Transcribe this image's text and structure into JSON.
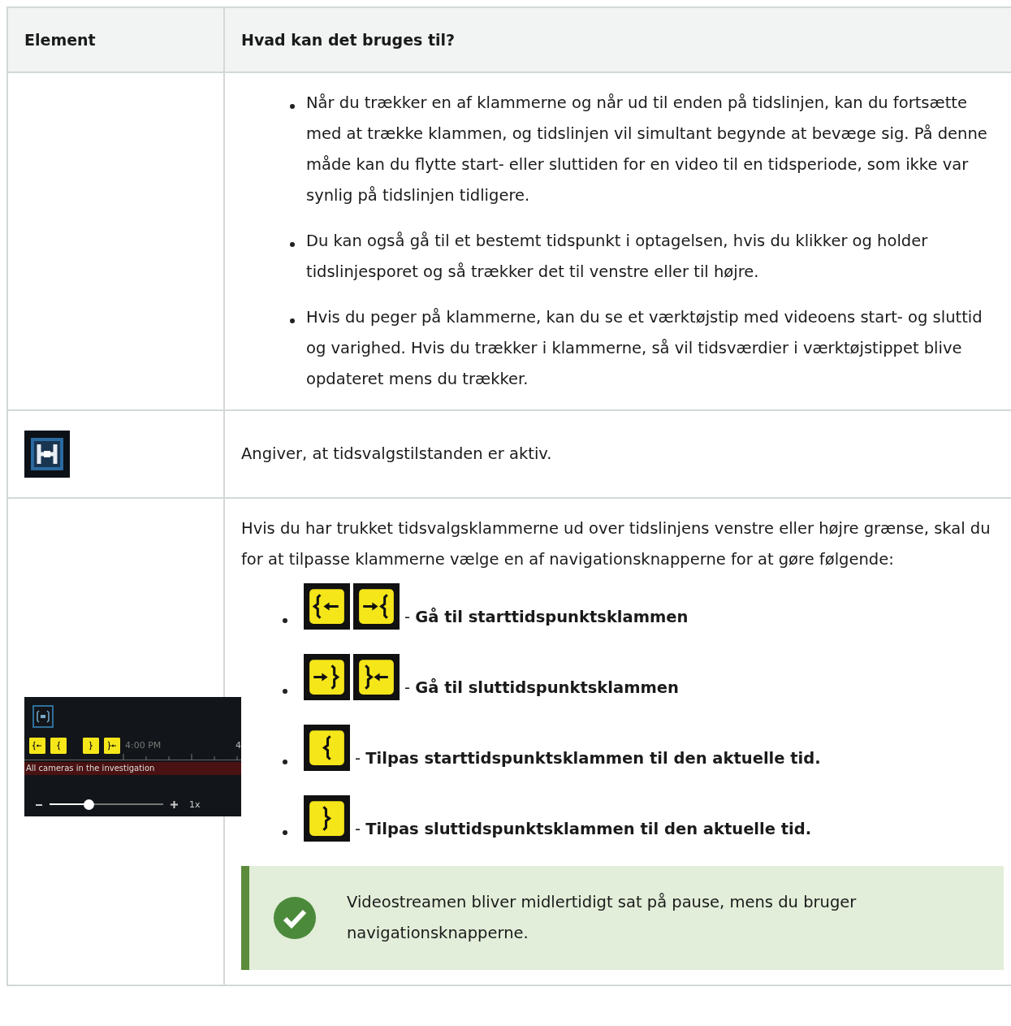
{
  "table": {
    "columns": [
      "Element",
      "Hvad kan det bruges til?"
    ],
    "rows": [
      {
        "kind": "bullets",
        "bullets": [
          "Når du trækker en af klammerne og når ud til enden på tidslinjen, kan du fortsætte med at trække klammen, og tidslinjen vil simultant begynde at bevæge sig. På denne måde kan du flytte start- eller sluttiden for en video til en tidsperiode, som ikke var synlig på tidslinjen tidligere.",
          "Du kan også gå til et bestemt tidspunkt i optagelsen, hvis du klikker og holder tidslinjesporet og så trækker det til venstre eller til højre.",
          "Hvis du peger på klammerne, kan du se et værktøjstip med videoens start- og sluttid og varighed. Hvis du trækker i klammerne, så vil tidsværdier i værktøjstippet blive opdateret mens du trækker."
        ]
      },
      {
        "kind": "icon",
        "text": "Angiver, at tidsvalgstilstanden er aktiv."
      },
      {
        "kind": "navigation",
        "timeline": {
          "time_label": "4:00 PM",
          "next_time_label": "4",
          "track_label": "All cameras in the investigation",
          "zoom": {
            "level": 0.34
          },
          "speed": "1x"
        },
        "intro": "Hvis du har trukket tidsvalgsklammerne ud over tidslinjens venstre eller højre grænse, skal du for at tilpasse klammerne vælge en af navigationsknapperne for at gøre følgende:",
        "nav_items": [
          {
            "text": "- **Gå til starttidspunktsklammen**"
          },
          {
            "text": "- **Gå til sluttidspunktsklammen**"
          },
          {
            "text": "- **Tilpas starttidspunktsklammen til den aktuelle tid.**"
          },
          {
            "text": "- **Tilpas sluttidspunktsklammen til den aktuelle tid.**"
          }
        ],
        "note": {
          "text": "Videostreamen bliver midlertidigt sat på pause, mens du bruger navigationsknapperne."
        }
      }
    ]
  }
}
